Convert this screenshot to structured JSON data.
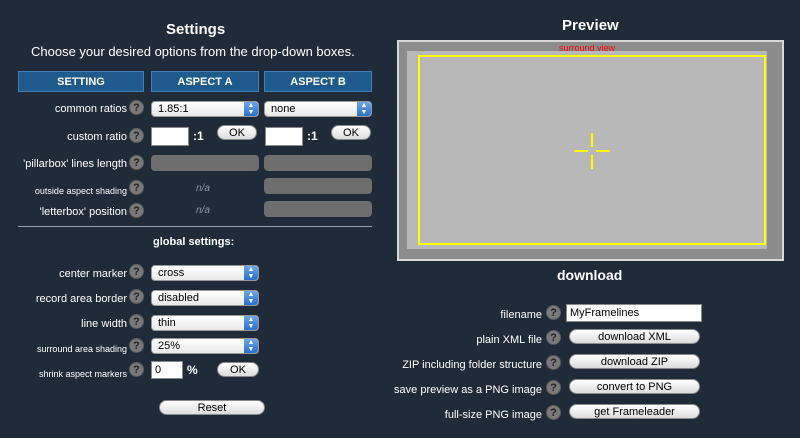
{
  "settings": {
    "title": "Settings",
    "subtitle": "Choose your desired options from the drop-down boxes.",
    "headers": {
      "setting": "SETTING",
      "aspect_a": "ASPECT A",
      "aspect_b": "ASPECT B"
    },
    "rows": {
      "common_ratios": {
        "label": "common ratios",
        "a_value": "1.85:1",
        "b_value": "none"
      },
      "custom_ratio": {
        "label": "custom ratio",
        "a_value": "",
        "b_value": "",
        "suffix": ":1",
        "ok": "OK"
      },
      "pillarbox": {
        "label": "'pillarbox' lines length"
      },
      "outside_shading": {
        "label": "outside aspect shading",
        "a_value": "n/a"
      },
      "letterbox": {
        "label": "'letterbox' position",
        "a_value": "n/a"
      }
    },
    "help_glyph": "?"
  },
  "global": {
    "title": "global settings:",
    "center_marker": {
      "label": "center marker",
      "value": "cross"
    },
    "record_area_border": {
      "label": "record area border",
      "value": "disabled"
    },
    "line_width": {
      "label": "line width",
      "value": "thin"
    },
    "surround_shading": {
      "label": "surround area shading",
      "value": "25%"
    },
    "shrink_markers": {
      "label": "shrink aspect markers",
      "value": "0",
      "unit": "%",
      "ok": "OK"
    },
    "reset": "Reset"
  },
  "preview": {
    "title": "Preview",
    "surround_label": "surround view",
    "colors": {
      "frame": "#ffff00",
      "surround_label": "#ff0000",
      "canvas": "#b8b8b8",
      "outer": "#8c8c8c"
    }
  },
  "download": {
    "title": "download",
    "filename": {
      "label": "filename",
      "value": "MyFramelines"
    },
    "xml": {
      "label": "plain XML file",
      "button": "download XML"
    },
    "zip": {
      "label": "ZIP including folder structure",
      "button": "download ZIP"
    },
    "png_preview": {
      "label": "save preview as a PNG image",
      "button": "convert to PNG"
    },
    "png_full": {
      "label": "full-size PNG image",
      "button": "get Frameleader"
    }
  }
}
